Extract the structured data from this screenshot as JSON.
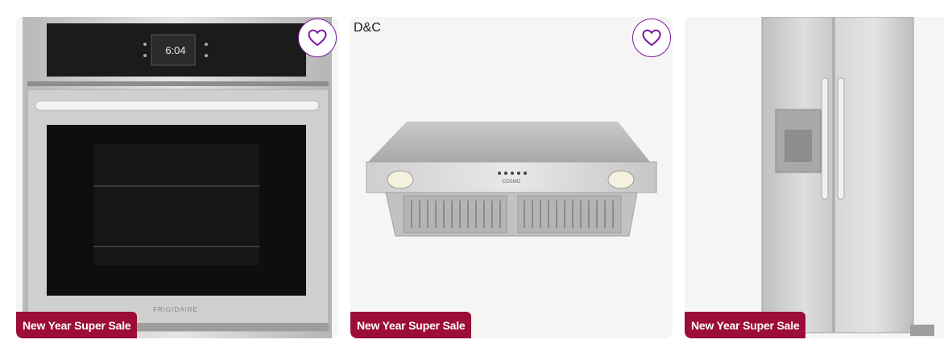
{
  "products": [
    {
      "brand": "",
      "badge": "New Year Super Sale",
      "image_label": "wall-oven",
      "oven_display": "6:04",
      "oven_brand_text": "FRIGIDAIRE",
      "favorite_icon": "heart-icon"
    },
    {
      "brand": "D&C",
      "badge": "New Year Super Sale",
      "image_label": "range-hood-insert",
      "hood_brand_text": "COSMO",
      "favorite_icon": "heart-icon"
    },
    {
      "brand": "",
      "badge": "New Year Super Sale",
      "image_label": "side-by-side-refrigerator",
      "favorite_icon": "heart-icon"
    }
  ],
  "colors": {
    "badge_bg": "#9c0d38",
    "favorite_accent": "#7b189f",
    "card_bg": "#f5f5f5"
  }
}
